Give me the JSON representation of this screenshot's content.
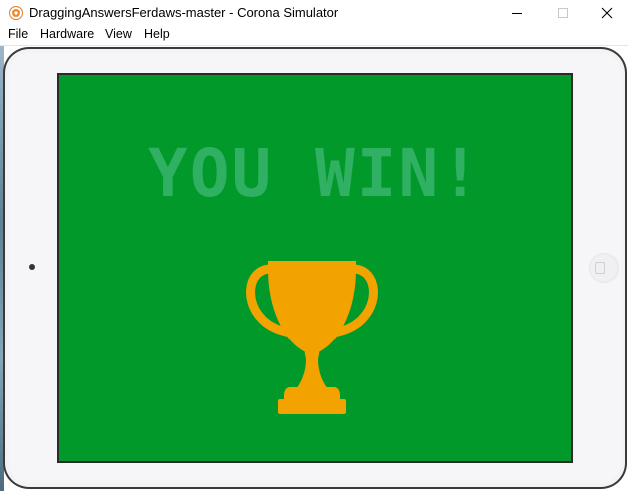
{
  "window": {
    "title": "DraggingAnswersFerdaws-master - Corona Simulator",
    "app_icon": "corona-icon",
    "controls": [
      "minimize-icon",
      "maximize-icon",
      "close-icon"
    ]
  },
  "menubar": {
    "items": [
      "File",
      "Hardware",
      "View",
      "Help"
    ]
  },
  "device": {
    "type": "tablet-landscape",
    "frame_color": "#f3f3f5"
  },
  "screen": {
    "background": "#02992b",
    "message": "YOU WIN!",
    "message_color": "#2fb063",
    "image": "trophy-icon",
    "image_color": "#f2a300"
  }
}
